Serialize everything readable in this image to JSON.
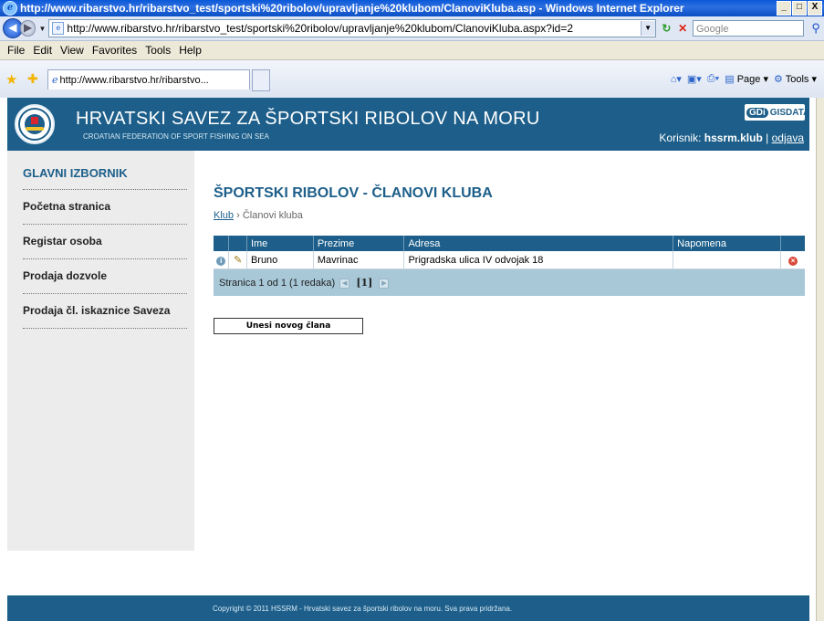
{
  "window": {
    "title": "http://www.ribarstvo.hr/ribarstvo_test/sportski%20ribolov/upravljanje%20klubom/ClanoviKluba.asp - Windows Internet Explorer",
    "controls": [
      "_",
      "□",
      "X"
    ]
  },
  "address_bar": {
    "url": "http://www.ribarstvo.hr/ribarstvo_test/sportski%20ribolov/upravljanje%20klubom/ClanoviKluba.aspx?id=2",
    "search_placeholder": "Google"
  },
  "menu": [
    "File",
    "Edit",
    "View",
    "Favorites",
    "Tools",
    "Help"
  ],
  "tab": {
    "label": "http://www.ribarstvo.hr/ribarstvo..."
  },
  "toolbar": {
    "page_label": "Page",
    "tools_label": "Tools"
  },
  "header": {
    "title": "HRVATSKI SAVEZ ZA ŠPORTSKI RIBOLOV NA MORU",
    "subtitle": "CROATIAN FEDERATION OF SPORT FISHING ON SEA",
    "brand_gdi": "GDi",
    "brand_gis": "GISDATA",
    "user_prefix": "Korisnik:",
    "username": "hssrm.klub",
    "separator": "|",
    "logout": "odjava"
  },
  "sidebar": {
    "title": "GLAVNI IZBORNIK",
    "items": [
      {
        "label": "Početna stranica"
      },
      {
        "label": "Registar osoba"
      },
      {
        "label": "Prodaja dozvole"
      },
      {
        "label": "Prodaja čl. iskaznice Saveza"
      }
    ]
  },
  "main": {
    "title": "ŠPORTSKI RIBOLOV - ČLANOVI KLUBA",
    "breadcrumb": {
      "link": "Klub",
      "sep": "›",
      "current": "Članovi kluba"
    },
    "table": {
      "columns": [
        "Ime",
        "Prezime",
        "Adresa",
        "Napomena"
      ],
      "rows": [
        {
          "ime": "Bruno",
          "prezime": "Mavrinac",
          "adresa": "Prigradska ulica IV odvojak 18",
          "napomena": ""
        }
      ]
    },
    "pager": {
      "text": "Stranica 1 od 1 (1 redaka)",
      "current": "[1]"
    },
    "new_button": "Unesi novog člana"
  },
  "footer": {
    "text": "Copyright © 2011 HSSRM - Hrvatski savez za športski ribolov na moru. Sva prava pridržana."
  }
}
